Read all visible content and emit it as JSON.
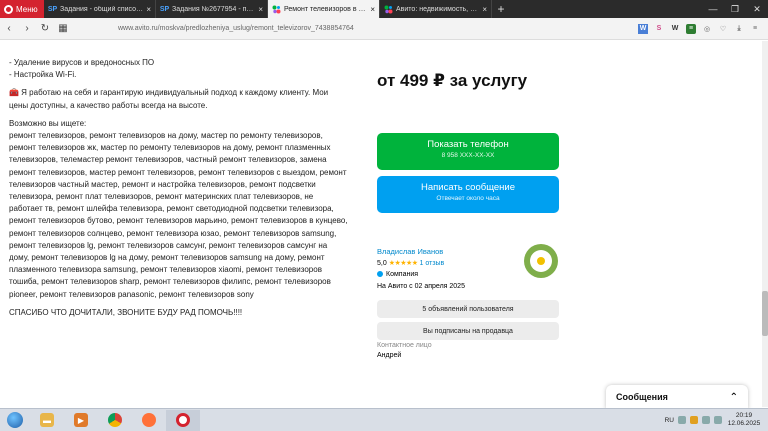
{
  "browser": {
    "menu_label": "Меню",
    "tabs": [
      {
        "icon": "SP",
        "title": "Задания - общий список ..."
      },
      {
        "icon": "SP",
        "title": "Задания №2677954 - про..."
      },
      {
        "icon": "avito-icon",
        "title": "Ремонт телевизоров в М..."
      },
      {
        "icon": "avito-icon",
        "title": "Авито: недвижимость, тра..."
      }
    ],
    "url": "www.avito.ru/moskva/predlozheniya_uslug/remont_televizorov_7438854764"
  },
  "description": {
    "bullets": [
      "- Удаление вирусов и вредоносных ПО",
      "- Настройка Wi-Fi."
    ],
    "approach": "🧰 Я работаю на себя и гарантирую индивидуальный подход к каждому клиенту. Мои цены доступны, а качество работы всегда на высоте.",
    "search_heading": "Возможно вы ищете:",
    "search_terms": "ремонт телевизоров, ремонт телевизоров на дому, мастер по ремонту телевизоров, ремонт телевизоров жк, мастер по ремонту телевизоров на дому, ремонт плазменных телевизоров, телемастер ремонт телевизоров, частный ремонт телевизоров, замена ремонт телевизоров, мастер ремонт телевизоров, ремонт телевизоров с выездом, ремонт телевизоров частный мастер, ремонт и настройка телевизоров, ремонт подсветки телевизора, ремонт плат телевизоров, ремонт материнских плат телевизоров, не работает тв, ремонт шлейфа телевизора, ремонт светодиодной подсветки телевизора, ремонт телевизоров бутово, ремонт телевизоров марьино, ремонт телевизоров в кунцево, ремонт телевизоров солнцево, ремонт телевизора юзао, ремонт телевизоров samsung, ремонт телевизоров lg, ремонт телевизоров самсунг, ремонт телевизоров самсунг на дому, ремонт телевизоров lg на дому, ремонт телевизоров samsung на дому, ремонт плазменного телевизора samsung, ремонт телевизоров xiaomi, ремонт телевизоров тошиба, ремонт телевизоров sharp, ремонт телевизоров филипс, ремонт телевизоров pioneer, ремонт телевизоров panasonic, ремонт телевизоров sony",
    "closing": "СПАСИБО ЧТО ДОЧИТАЛИ, ЗВОНИТЕ БУДУ РАД ПОМОЧЬ!!!!"
  },
  "offer": {
    "price": "от 499 ₽ за услугу",
    "phone_button": {
      "label": "Показать телефон",
      "sub": "8 958 XXX-XX-XX"
    },
    "message_button": {
      "label": "Написать сообщение",
      "sub": "Отвечает около часа"
    }
  },
  "seller": {
    "name": "Владислав Иванов",
    "rating": "5,0",
    "stars": "★★★★★",
    "reviews": "1 отзыв",
    "type": "Компания",
    "since": "На Авито с 02 апреля 2025",
    "ads_button": "5 объявлений пользователя",
    "subscribed_button": "Вы подписаны на продавца",
    "contact_label": "Контактное лицо",
    "contact_name": "Андрей"
  },
  "messages_panel": {
    "title": "Сообщения"
  },
  "taskbar": {
    "lang": "RU",
    "time": "20:19",
    "date": "12.06.2025"
  },
  "colors": {
    "green": "#00b33c",
    "blue": "#00a0f0",
    "opera_red": "#d4232f"
  }
}
